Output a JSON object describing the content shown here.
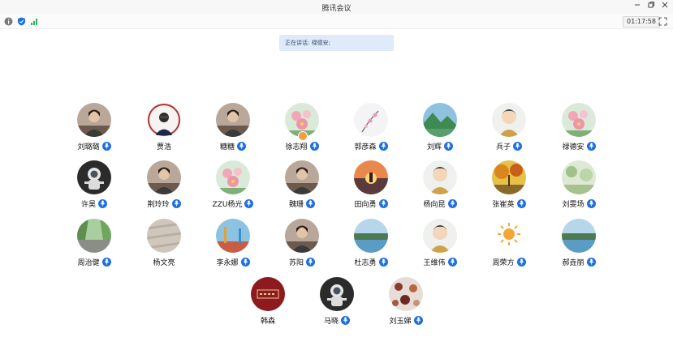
{
  "window": {
    "title": "腾讯会议",
    "timer": "01:17:58"
  },
  "toolbar": {
    "icons": [
      "info-icon",
      "shield-icon",
      "signal-icon"
    ]
  },
  "speaking": {
    "label": "正在讲话:",
    "names": "禄德安;"
  },
  "colors": {
    "accent": "#1e6fe0",
    "banner": "#dfeafb",
    "hand": "#f59d3a"
  },
  "participants": [
    {
      "name": "刘璐璐",
      "mic": true,
      "avatar": "portrait-photo"
    },
    {
      "name": "贾浩",
      "mic": false,
      "avatar": "university-seal-photo"
    },
    {
      "name": "糖糖",
      "mic": true,
      "avatar": "portrait-photo"
    },
    {
      "name": "徐志翔",
      "mic": true,
      "avatar": "flower-photo",
      "hand": true
    },
    {
      "name": "郭彦森",
      "mic": true,
      "avatar": "blossom-drawing"
    },
    {
      "name": "刘辉",
      "mic": true,
      "avatar": "landscape-photo"
    },
    {
      "name": "兵子",
      "mic": true,
      "avatar": "cartoon-avatar"
    },
    {
      "name": "禄德安",
      "mic": true,
      "avatar": "flower-photo"
    },
    {
      "name": "许昊",
      "mic": true,
      "avatar": "astronaut-photo"
    },
    {
      "name": "荆玲玲",
      "mic": true,
      "avatar": "portrait-photo"
    },
    {
      "name": "ZZU杨光",
      "mic": true,
      "avatar": "flower-photo"
    },
    {
      "name": "魏珊",
      "mic": true,
      "avatar": "portrait-photo"
    },
    {
      "name": "田向勇",
      "mic": true,
      "avatar": "sunset-photo"
    },
    {
      "name": "杨向昆",
      "mic": true,
      "avatar": "cartoon-avatar"
    },
    {
      "name": "张崔英",
      "mic": true,
      "avatar": "autumn-photo"
    },
    {
      "name": "刘雯场",
      "mic": true,
      "avatar": "nature-photo"
    },
    {
      "name": "周治健",
      "mic": true,
      "avatar": "street-photo"
    },
    {
      "name": "杨文亮",
      "mic": false,
      "avatar": "texture-photo"
    },
    {
      "name": "李永娜",
      "mic": true,
      "avatar": "playground-photo"
    },
    {
      "name": "苏阳",
      "mic": true,
      "avatar": "portrait-photo"
    },
    {
      "name": "杜志勇",
      "mic": true,
      "avatar": "lake-photo"
    },
    {
      "name": "王维伟",
      "mic": true,
      "avatar": "cartoon-avatar"
    },
    {
      "name": "周荣方",
      "mic": true,
      "avatar": "sun-icon-avatar"
    },
    {
      "name": "郝垚丽",
      "mic": true,
      "avatar": "lake-photo"
    },
    {
      "name": "韩森",
      "mic": false,
      "avatar": "red-stamp-photo"
    },
    {
      "name": "马晓",
      "mic": true,
      "avatar": "astronaut-photo"
    },
    {
      "name": "刘玉娣",
      "mic": true,
      "avatar": "floral-pattern-photo"
    }
  ]
}
